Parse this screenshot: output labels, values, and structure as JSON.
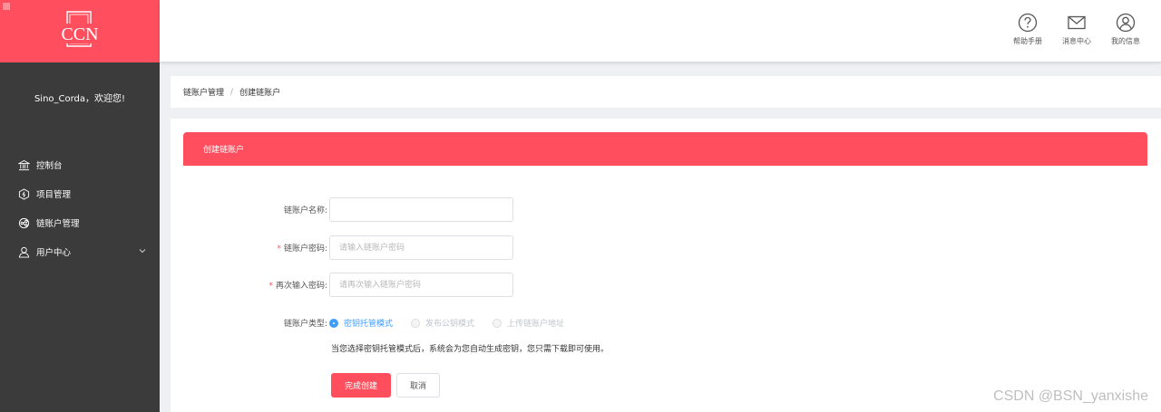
{
  "brand": {
    "logo_text": "CCN",
    "accent": "#ff4f5e"
  },
  "sidebar": {
    "welcome": "Sino_Corda，欢迎您!",
    "items": [
      {
        "label": "控制台",
        "icon": "bank-icon"
      },
      {
        "label": "项目管理",
        "icon": "project-icon"
      },
      {
        "label": "链账户管理",
        "icon": "chain-icon"
      },
      {
        "label": "用户中心",
        "icon": "user-icon",
        "expandable": true
      }
    ]
  },
  "header": {
    "actions": [
      {
        "label": "帮助手册",
        "icon": "help-icon"
      },
      {
        "label": "消息中心",
        "icon": "mail-icon"
      },
      {
        "label": "我的信息",
        "icon": "profile-icon"
      }
    ]
  },
  "breadcrumb": {
    "parent": "链账户管理",
    "separator": "/",
    "current": "创建链账户"
  },
  "card": {
    "title": "创建链账户"
  },
  "form": {
    "name_label": "链账户名称:",
    "name_value": "",
    "password_label": "链账户密码:",
    "password_placeholder": "请输入链账户密码",
    "confirm_label": "再次输入密码:",
    "confirm_placeholder": "请再次输入链账户密码",
    "type_label": "链账户类型:",
    "type_options": [
      {
        "label": "密钥托管模式",
        "selected": true,
        "disabled": false
      },
      {
        "label": "发布公钥模式",
        "selected": false,
        "disabled": true
      },
      {
        "label": "上传链账户地址",
        "selected": false,
        "disabled": true
      }
    ],
    "hint": "当您选择密钥托管模式后，系统会为您自动生成密钥，您只需下载即可使用。",
    "submit_label": "完成创建",
    "cancel_label": "取消"
  },
  "watermark": "CSDN @BSN_yanxishe"
}
